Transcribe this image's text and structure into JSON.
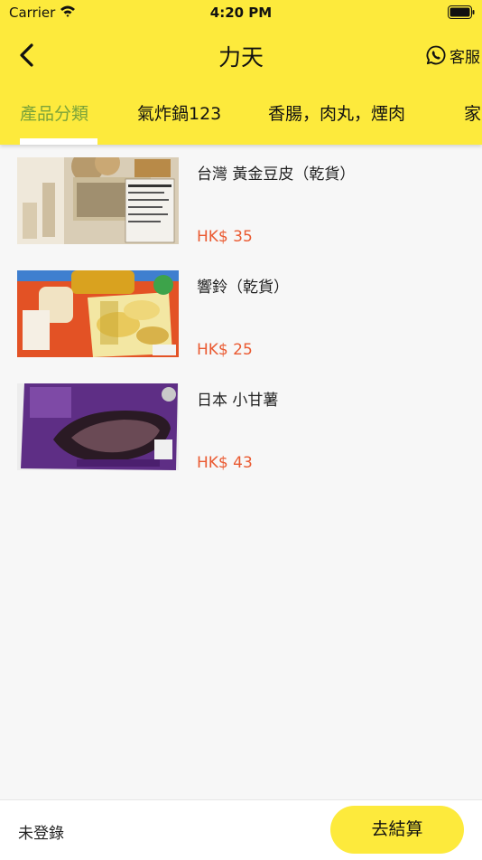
{
  "status_bar": {
    "carrier": "Carrier",
    "time": "4:20 PM"
  },
  "nav": {
    "title": "力天",
    "service_label": "客服"
  },
  "tabs": [
    {
      "label": "產品分類",
      "active": true
    },
    {
      "label": "氣炸鍋123",
      "active": false
    },
    {
      "label": "香腸，肉丸，煙肉",
      "active": false
    },
    {
      "label": "家",
      "active": false
    }
  ],
  "products": [
    {
      "name": "台灣 黃金豆皮（乾貨）",
      "price": "HK$ 35",
      "image": "tofu-skin-package-photo"
    },
    {
      "name": "響鈴（乾貨）",
      "price": "HK$ 25",
      "image": "bean-curd-roll-package-photo"
    },
    {
      "name": "日本 小甘薯",
      "price": "HK$ 43",
      "image": "sweet-potato-package-photo"
    }
  ],
  "footer": {
    "login_status": "未登錄",
    "checkout_label": "去結算"
  },
  "colors": {
    "header_yellow": "#fdea3c",
    "active_tab": "#7ba33a",
    "price_red": "#ea5a31"
  }
}
